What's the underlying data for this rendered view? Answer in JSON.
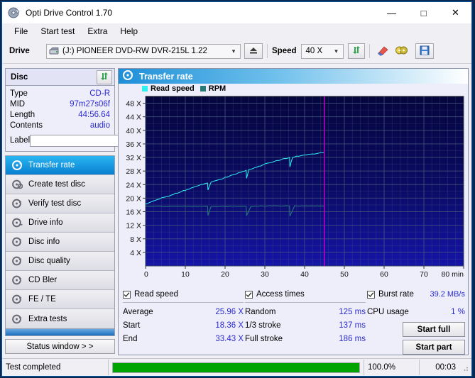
{
  "window": {
    "title": "Opti Drive Control 1.70",
    "icon": "disc-app-icon",
    "minimize": "—",
    "maximize": "□",
    "close": "✕"
  },
  "menu": {
    "items": [
      "File",
      "Start test",
      "Extra",
      "Help"
    ]
  },
  "toolbar": {
    "drive_label": "Drive",
    "drive_value": "(J:)   PIONEER DVD-RW  DVR-215L 1.22",
    "eject_icon": "eject-icon",
    "speed_label": "Speed",
    "speed_value": "40 X",
    "refresh_icon": "refresh-icon",
    "erase_icon": "erase-icon",
    "media_icon": "media-icon",
    "save_icon": "save-icon"
  },
  "disc": {
    "title": "Disc",
    "refresh_icon": "refresh-disc-icon",
    "rows": [
      {
        "key": "Type",
        "value": "CD-R"
      },
      {
        "key": "MID",
        "value": "97m27s06f"
      },
      {
        "key": "Length",
        "value": "44:56.64"
      },
      {
        "key": "Contents",
        "value": "audio"
      }
    ],
    "label_key": "Label",
    "label_value": "",
    "label_placeholder": "",
    "label_button_icon": "cd-icon"
  },
  "nav": {
    "items": [
      {
        "label": "Transfer rate",
        "icon": "disc-speed-icon",
        "selected": true
      },
      {
        "label": "Create test disc",
        "icon": "disc-burn-icon",
        "selected": false
      },
      {
        "label": "Verify test disc",
        "icon": "disc-verify-icon",
        "selected": false
      },
      {
        "label": "Drive info",
        "icon": "drive-info-icon",
        "selected": false
      },
      {
        "label": "Disc info",
        "icon": "disc-info-icon",
        "selected": false
      },
      {
        "label": "Disc quality",
        "icon": "disc-quality-icon",
        "selected": false
      },
      {
        "label": "CD Bler",
        "icon": "disc-bler-icon",
        "selected": false
      },
      {
        "label": "FE / TE",
        "icon": "disc-fete-icon",
        "selected": false
      },
      {
        "label": "Extra tests",
        "icon": "disc-extra-icon",
        "selected": false
      }
    ],
    "status_window": "Status window > >"
  },
  "panel": {
    "title": "Transfer rate",
    "icon": "disc-speed-icon"
  },
  "chart_data": {
    "type": "line",
    "title": "Transfer rate",
    "xlabel": "80 min",
    "ylabel": "",
    "xlim": [
      0,
      80
    ],
    "ylim": [
      0,
      50
    ],
    "grid": true,
    "legend_position": "top-left",
    "xticks": [
      0,
      10,
      20,
      30,
      40,
      50,
      60,
      70,
      80
    ],
    "xticklabels": [
      "0",
      "10",
      "20",
      "30",
      "40",
      "50",
      "60",
      "70",
      "80 min"
    ],
    "yticks": [
      4,
      8,
      12,
      16,
      20,
      24,
      28,
      32,
      36,
      40,
      44,
      48
    ],
    "yticklabels": [
      "4 X",
      "8 X",
      "12 X",
      "16 X",
      "20 X",
      "24 X",
      "28 X",
      "32 X",
      "36 X",
      "40 X",
      "44 X",
      "48 X"
    ],
    "plot_bg": "#000066",
    "grid_color": "#4a5a7a",
    "marker_line": {
      "x": 44.95,
      "color": "#cc00cc",
      "label": "disc end"
    },
    "series": [
      {
        "name": "Read speed",
        "color": "#2ff0f0",
        "x": [
          0.0,
          1.5,
          3.0,
          4.5,
          6.0,
          7.5,
          9.0,
          10.5,
          12.0,
          13.5,
          15.0,
          15.6,
          15.7,
          16.5,
          18.0,
          19.5,
          21.0,
          22.5,
          24.0,
          25.3,
          25.4,
          26.0,
          27.5,
          29.0,
          30.5,
          32.0,
          33.5,
          35.0,
          36.2,
          36.3,
          37.0,
          38.5,
          40.0,
          41.5,
          43.0,
          44.5,
          44.95
        ],
        "y": [
          18.36,
          18.95,
          19.55,
          20.15,
          20.75,
          21.35,
          21.95,
          22.55,
          23.15,
          23.7,
          24.3,
          24.45,
          22.4,
          24.7,
          25.3,
          25.9,
          26.5,
          27.1,
          27.7,
          28.2,
          25.9,
          28.45,
          29.0,
          29.6,
          30.2,
          30.7,
          31.2,
          31.7,
          32.0,
          29.3,
          32.1,
          32.5,
          32.8,
          33.0,
          33.2,
          33.4,
          33.43
        ]
      },
      {
        "name": "RPM",
        "color": "#2a7a7a",
        "x": [
          0.0,
          5.0,
          10.0,
          15.0,
          15.6,
          15.7,
          16.5,
          20.0,
          25.0,
          25.3,
          25.4,
          26.5,
          30.0,
          34.0,
          36.2,
          36.3,
          37.5,
          40.0,
          44.95
        ],
        "y": [
          17.6,
          17.6,
          17.6,
          17.6,
          17.6,
          14.9,
          17.6,
          17.6,
          17.6,
          17.6,
          14.8,
          17.6,
          17.7,
          17.7,
          17.7,
          14.7,
          17.7,
          17.7,
          17.7
        ]
      }
    ]
  },
  "results": {
    "read_speed": {
      "checkbox_label": "Read speed",
      "checked": true,
      "rows": [
        {
          "key": "Average",
          "value": "25.96 X"
        },
        {
          "key": "Start",
          "value": "18.36 X"
        },
        {
          "key": "End",
          "value": "33.43 X"
        }
      ]
    },
    "access_times": {
      "checkbox_label": "Access times",
      "checked": true,
      "rows": [
        {
          "key": "Random",
          "value": "125 ms"
        },
        {
          "key": "1/3 stroke",
          "value": "137 ms"
        },
        {
          "key": "Full stroke",
          "value": "186 ms"
        }
      ]
    },
    "burst": {
      "checkbox_label": "Burst rate",
      "checked": true,
      "burst_value": "39.2 MB/s",
      "cpu_key": "CPU usage",
      "cpu_value": "1 %",
      "start_full": "Start full",
      "start_part": "Start part"
    }
  },
  "statusbar": {
    "message": "Test completed",
    "progress_percent": 100.0,
    "progress_text": "100.0%",
    "elapsed": "00:03",
    "progress_color": "#00a400"
  }
}
